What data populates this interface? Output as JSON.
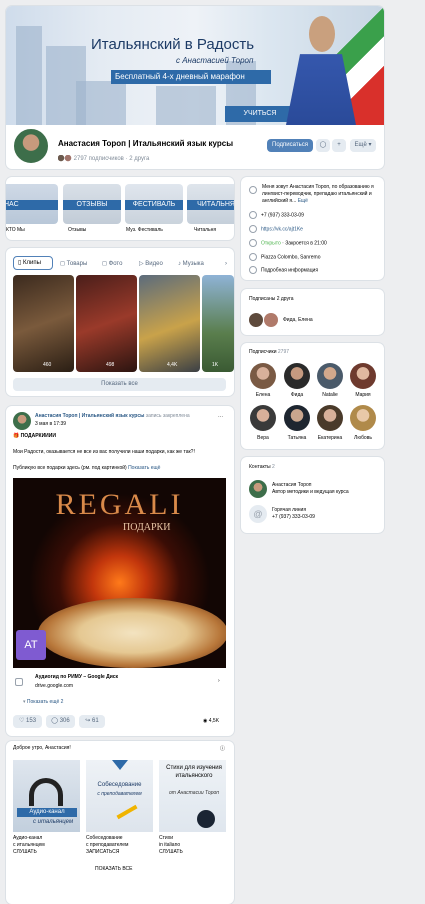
{
  "cover": {
    "title": "Итальянский в Радость",
    "subtitle": "с Анастасией Тороп",
    "marathon": "Бесплатный 4-х дневный марафон",
    "learn_button": "УЧИТЬСЯ"
  },
  "profile": {
    "name": "Анастасия Тороп | Итальянский язык курсы",
    "followers": "2797 подписчиков · 2 друга",
    "subscribe_button": "Подписаться",
    "more_button": "Ещё"
  },
  "highlights": [
    {
      "title": "НАС",
      "caption": "КТО Мы"
    },
    {
      "title": "ОТЗЫВЫ",
      "caption": "Отзывы"
    },
    {
      "title": "ФЕСТИВАЛЬ",
      "caption": "Муз. Фестиваль"
    },
    {
      "title": "ЧИТАЛЬНЯ",
      "caption": "Читальня"
    }
  ],
  "media_tabs": [
    "Клипы",
    "Товары",
    "Фото",
    "Видео",
    "Музыка"
  ],
  "clips": [
    {
      "views": "460"
    },
    {
      "views": "498"
    },
    {
      "views": "4,4K"
    },
    {
      "views": "1K"
    }
  ],
  "show_all": "Показать все",
  "post": {
    "author": "Анастасия Тороп | Итальянский язык курсы",
    "pinned": "запись закреплена",
    "date": "3 мая в 17:39",
    "heading": "🎁 ПОДАРКИИИИ",
    "text1": "Мои Радости, оказывается не все из вас получили наши подарки, как же так?!",
    "text2": "Публикую все подарки здесь (рм. под картинкой)",
    "show_more": "Показать ещё",
    "image_title": "REGALI",
    "image_subtitle": "ПОДАРКИ",
    "logo_text": "AT",
    "link_title": "Аудиогид по РИМУ – Google Диск",
    "link_domain": "drive.google.com",
    "link_more": "Показать ещё 2",
    "likes": "153",
    "comments": "306",
    "shares": "61",
    "views": "4,5K"
  },
  "feed": {
    "greeting": "Доброе утро, Анастасия!",
    "cards": [
      {
        "banner": "Аудио-канал",
        "banner2": "с итальянцем",
        "title": "Аудио-канал",
        "sub": "с итальянцем",
        "action": "СЛУШАТЬ"
      },
      {
        "banner": "Собеседование",
        "banner2": "с преподавателем",
        "title": "Собеседование",
        "sub": "с преподавателем",
        "action": "ЗАПИСАТЬСЯ"
      },
      {
        "banner": "Стихи для изучения итальянского",
        "banner2": "от Анастасии Тороп",
        "title": "Стихи",
        "sub": "in italiano",
        "action": "СЛУШАТЬ"
      }
    ],
    "footer": "ПОКАЗАТЬ ВСЕ"
  },
  "info": {
    "about": "Меня зовут Анастасия Тороп, по образованию я лингвист-переводчик, препадаю итальянский и английский я...",
    "about_more": "Ещё",
    "phone": "+7 (937) 333-03-09",
    "link": "https://vk.cc/ajt1Ke",
    "open_label": "Открыто",
    "open_until": "· Закроется в 21:00",
    "address": "Piazza Colombo, Sanremo",
    "details": "Подробная информация"
  },
  "friends": {
    "title": "Подписаны 2 друга",
    "names": "Фида, Елена"
  },
  "subscribers": {
    "title": "Подписчики",
    "count": "2797",
    "people": [
      "Елена",
      "Фида",
      "Natalie",
      "Мария",
      "Вера",
      "Татьяна",
      "Екатерина",
      "Любовь"
    ]
  },
  "contacts": {
    "title": "Контакты",
    "count": "2",
    "person_name": "Анастасия Тороп",
    "person_role": "Автор методики и ведущая курса",
    "phone_label": "Горячая линия",
    "phone": "+7 (937) 333-03-09"
  }
}
